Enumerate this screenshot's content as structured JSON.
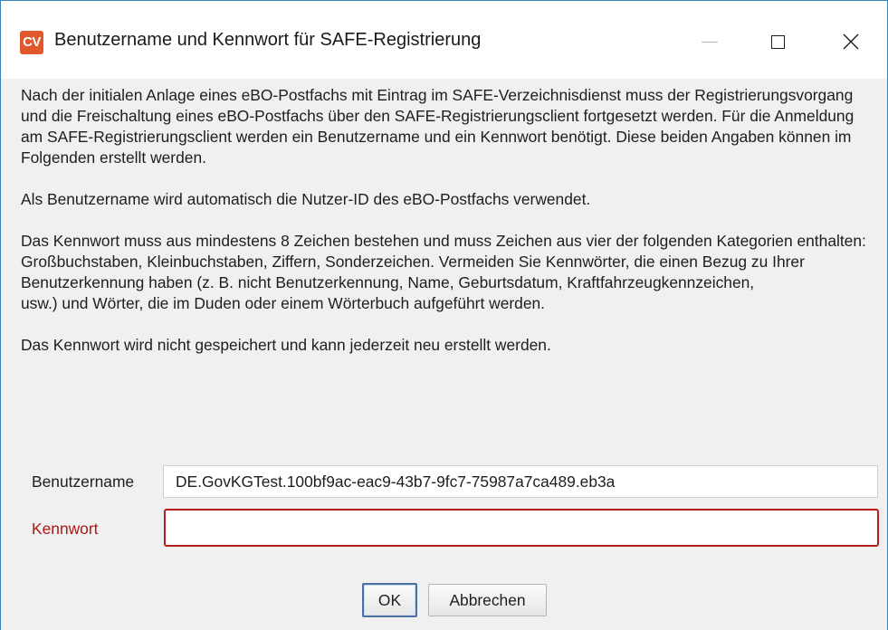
{
  "window": {
    "icon_text": "CV",
    "title": "Benutzername und Kennwort für SAFE-Registrierung",
    "accent_color": "#e2582d"
  },
  "description": {
    "paragraph1": "Nach der initialen Anlage eines eBO-Postfachs mit Eintrag im SAFE-Verzeichnisdienst muss der Registrierungsvorgang und die Freischaltung eines eBO-Postfachs über den SAFE-Registrierungsclient fortgesetzt werden. Für die Anmeldung am SAFE-Registrierungsclient werden ein Benutzername und ein Kennwort benötigt. Diese beiden Angaben können im Folgenden erstellt werden.",
    "paragraph2": "Als Benutzername wird automatisch die Nutzer-ID des eBO-Postfachs verwendet.",
    "paragraph3_line1": "Das Kennwort muss aus mindestens 8 Zeichen bestehen und muss Zeichen aus vier der folgenden Kategorien enthalten: Großbuchstaben, Kleinbuchstaben, Ziffern, Sonderzeichen. Vermeiden Sie Kennwörter, die einen Bezug zu Ihrer Benutzerkennung haben (z. B. nicht Benutzerkennung, Name, Geburtsdatum, Kraftfahrzeugkennzeichen,",
    "paragraph3_line2": "usw.) und Wörter, die im Duden oder einem Wörterbuch aufgeführt werden.",
    "paragraph4": "Das Kennwort wird nicht gespeichert und kann jederzeit neu erstellt werden."
  },
  "form": {
    "username_label": "Benutzername",
    "username_value": "DE.GovKGTest.100bf9ac-eac9-43b7-9fc7-75987a7ca489.eb3a",
    "password_label": "Kennwort",
    "password_value": "",
    "error_color": "#b81c1c"
  },
  "buttons": {
    "ok_label": "OK",
    "cancel_label": "Abbrechen"
  }
}
